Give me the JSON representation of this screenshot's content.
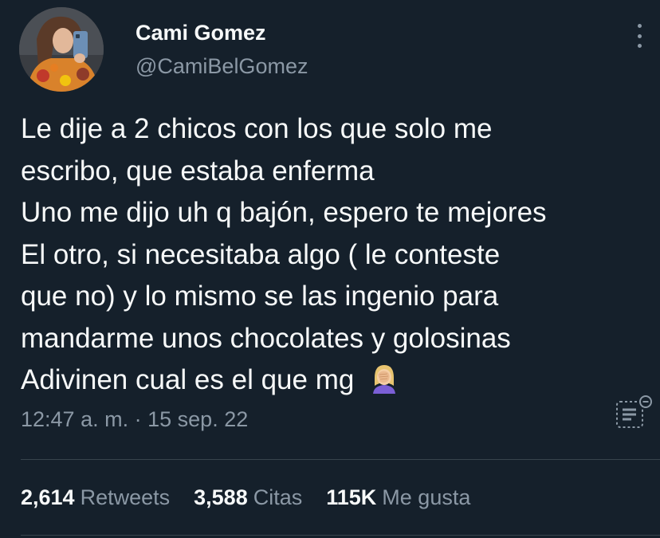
{
  "author": {
    "name": "Cami Gomez",
    "handle": "@CamiBelGomez"
  },
  "tweet": {
    "lines": [
      "Le dije a 2 chicos con los que solo me",
      "escribo, que estaba enferma",
      "Uno me dijo uh q bajón, espero te mejores",
      "El otro, si necesitaba algo ( le conteste",
      "que no) y lo mismo se las ingenio para",
      "mandarme unos chocolates y golosinas",
      "Adivinen cual es el que mg"
    ],
    "emoji": "face-palm-emoji",
    "time": "12:47 a. m.",
    "separator": "·",
    "date": "15 sep. 22"
  },
  "stats": {
    "retweets": {
      "count": "2,614",
      "label": "Retweets"
    },
    "quotes": {
      "count": "3,588",
      "label": "Citas"
    },
    "likes": {
      "count": "115K",
      "label": "Me gusta"
    }
  },
  "icons": {
    "more": "more-vertical-icon",
    "translate": "translate-icon"
  },
  "colors": {
    "background": "#15202b",
    "primary_text": "#f7f9f9",
    "secondary_text": "#8b98a5",
    "divider": "#38444d"
  }
}
